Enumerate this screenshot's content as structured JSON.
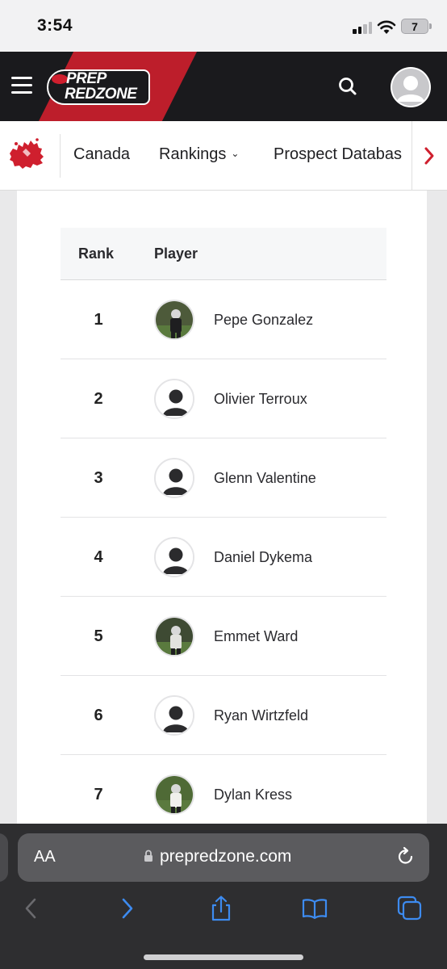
{
  "status_bar": {
    "time": "3:54",
    "battery": "7"
  },
  "header": {
    "logo_line1": "PREP",
    "logo_line2": "REDZONE"
  },
  "subnav": {
    "items": [
      {
        "label": "Canada"
      },
      {
        "label": "Rankings"
      },
      {
        "label": "Prospect Databas"
      }
    ]
  },
  "table": {
    "headers": {
      "rank": "Rank",
      "player": "Player"
    },
    "rows": [
      {
        "rank": "1",
        "name": "Pepe Gonzalez",
        "photo": "player-photo"
      },
      {
        "rank": "2",
        "name": "Olivier Terroux",
        "photo": "default-silhouette"
      },
      {
        "rank": "3",
        "name": "Glenn Valentine",
        "photo": "default-silhouette"
      },
      {
        "rank": "4",
        "name": "Daniel Dykema",
        "photo": "default-silhouette"
      },
      {
        "rank": "5",
        "name": "Emmet Ward",
        "photo": "player-photo"
      },
      {
        "rank": "6",
        "name": "Ryan Wirtzfeld",
        "photo": "default-silhouette"
      },
      {
        "rank": "7",
        "name": "Dylan Kress",
        "photo": "player-photo"
      }
    ]
  },
  "browser": {
    "aa_label": "AA",
    "url": "prepredzone.com"
  },
  "colors": {
    "brand_red": "#cf1f2e",
    "header_dark": "#1a1a1d",
    "safari_blue": "#3d8bf0"
  }
}
